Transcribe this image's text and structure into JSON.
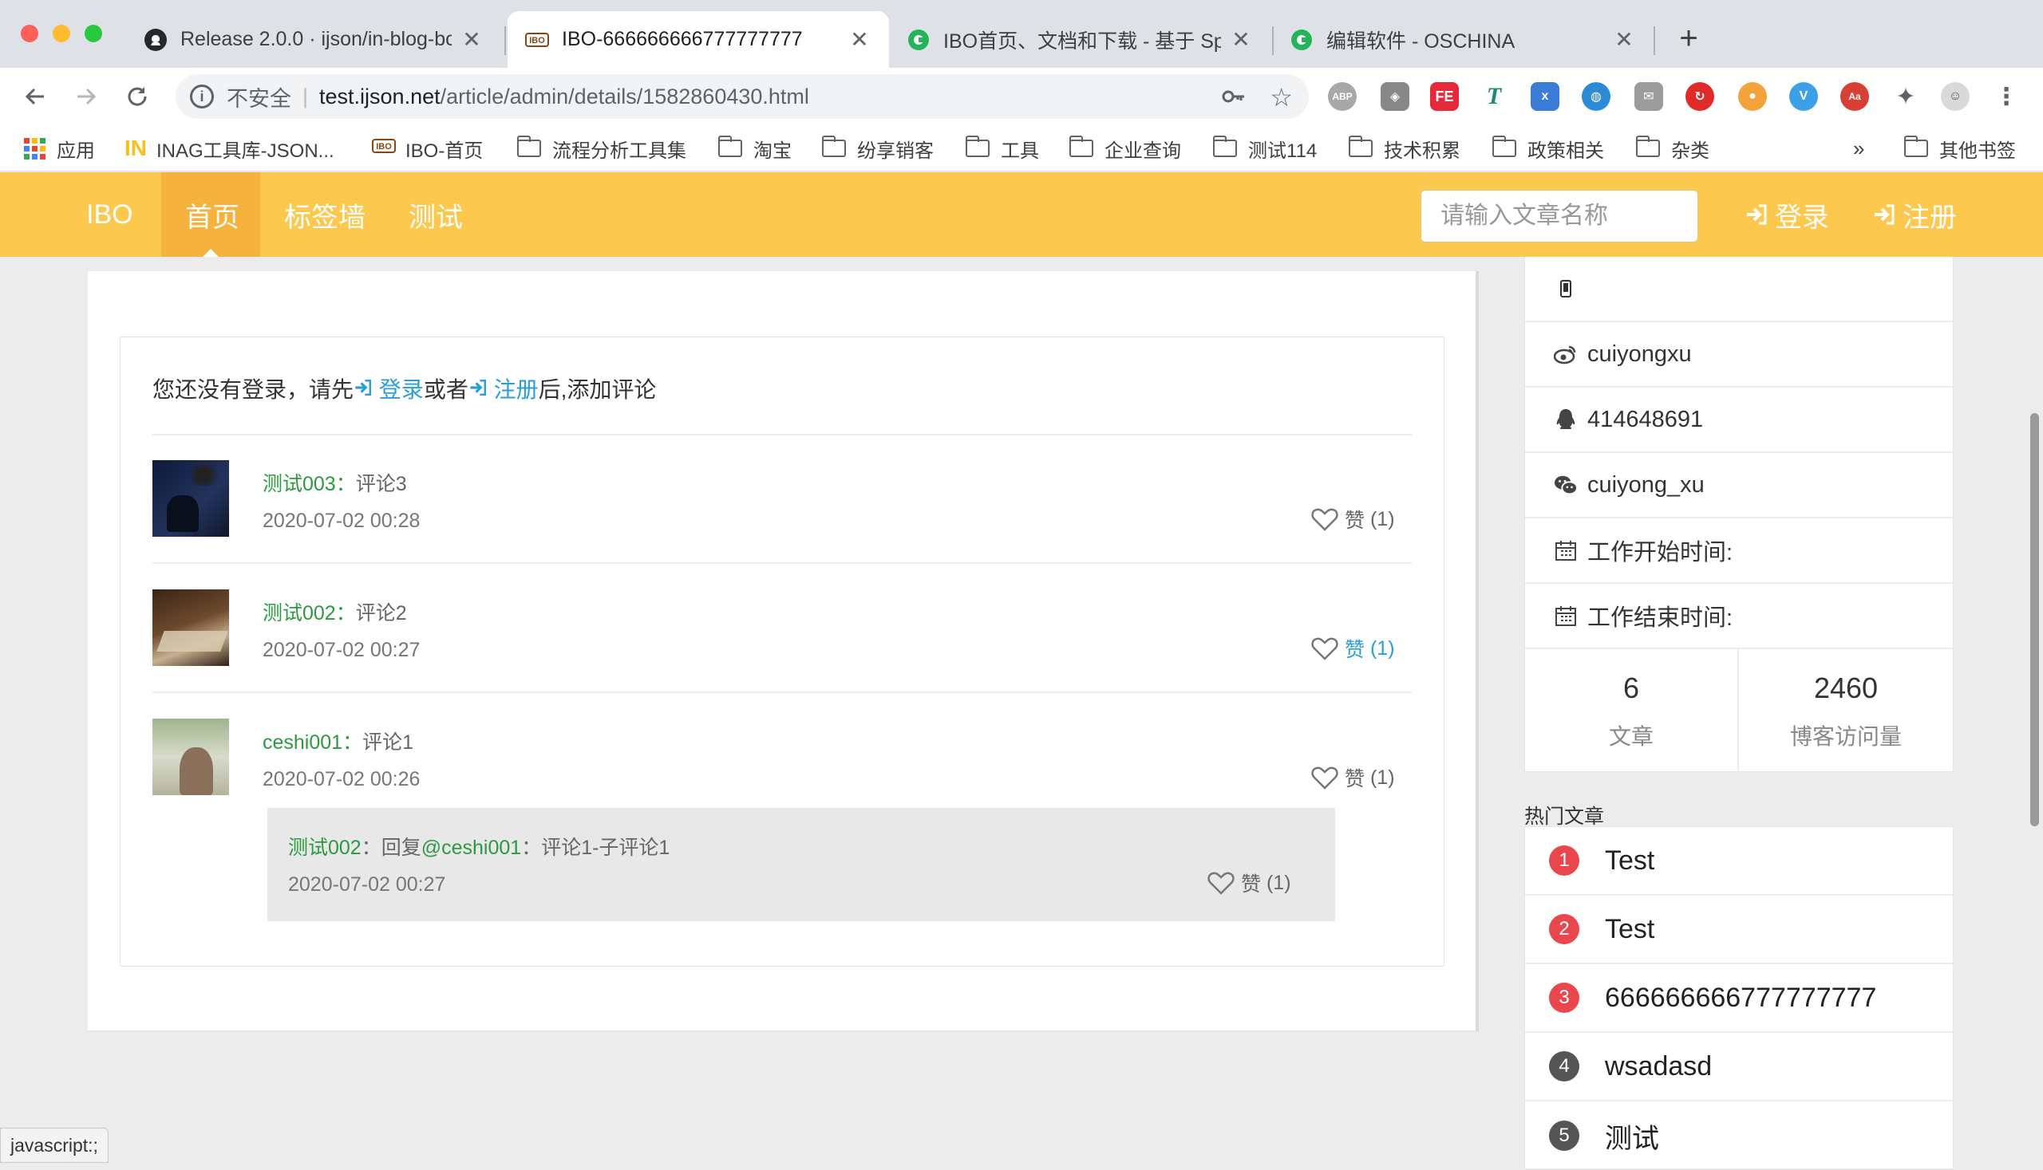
{
  "browser": {
    "tabs": [
      {
        "title": "Release 2.0.0 · ijson/in-blog-bc",
        "favicon": "github-icon"
      },
      {
        "title": "IBO-666666666777777777",
        "favicon": "ibo-icon",
        "active": true
      },
      {
        "title": "IBO首页、文档和下载 - 基于 Sp",
        "favicon": "oschina-icon"
      },
      {
        "title": "编辑软件 - OSCHINA",
        "favicon": "oschina-icon"
      }
    ],
    "security_label": "不安全",
    "url_host": "test.ijson.net",
    "url_path": "/article/admin/details/1582860430.html",
    "bookmarks": [
      {
        "label": "应用",
        "icon": "apps-grid-icon"
      },
      {
        "label": "INAG工具库-JSON...",
        "icon": "inag-icon"
      },
      {
        "label": "IBO-首页",
        "icon": "ibo-icon"
      },
      {
        "label": "流程分析工具集",
        "icon": "folder-icon"
      },
      {
        "label": "淘宝",
        "icon": "folder-icon"
      },
      {
        "label": "纷享销客",
        "icon": "folder-icon"
      },
      {
        "label": "工具",
        "icon": "folder-icon"
      },
      {
        "label": "企业查询",
        "icon": "folder-icon"
      },
      {
        "label": "测试114",
        "icon": "folder-icon"
      },
      {
        "label": "技术积累",
        "icon": "folder-icon"
      },
      {
        "label": "政策相关",
        "icon": "folder-icon"
      },
      {
        "label": "杂类",
        "icon": "folder-icon"
      }
    ],
    "bookmarks_overflow": "»",
    "other_bookmarks": "其他书签",
    "status_url": "javascript:;"
  },
  "site": {
    "brand": "IBO",
    "nav": [
      "首页",
      "标签墙",
      "测试"
    ],
    "search_placeholder": "请输入文章名称",
    "login": "登录",
    "register": "注册",
    "colors": {
      "nav_bg": "#fcc94e",
      "nav_active": "#f5b23c",
      "link": "#2a9fd6",
      "username": "#2c9a3f"
    }
  },
  "comments": {
    "prompt_prefix": "您还没有登录，请先",
    "login": "登录",
    "or": "或者",
    "register": "注册",
    "prompt_suffix": "后,添加评论",
    "items": [
      {
        "user": "测试003：",
        "text": "评论3",
        "time": "2020-07-02 00:28",
        "like_label": "赞",
        "like_count": "(1)"
      },
      {
        "user": "测试002：",
        "text": "评论2",
        "time": "2020-07-02 00:27",
        "like_label": "赞",
        "like_count": "(1)"
      },
      {
        "user": "ceshi001：",
        "text": "评论1",
        "time": "2020-07-02 00:26",
        "like_label": "赞",
        "like_count": "(1)"
      }
    ],
    "reply": {
      "user": "测试002",
      "sep": "：回复",
      "target": "@ceshi001",
      "text": "：评论1-子评论1",
      "time": "2020-07-02 00:27",
      "like_label": "赞",
      "like_count": "(1)"
    }
  },
  "profile": {
    "weibo": "cuiyongxu",
    "qq": "414648691",
    "wechat": "cuiyong_xu",
    "work_start": "工作开始时间:",
    "work_end": "工作结束时间:",
    "articles_count": "6",
    "articles_label": "文章",
    "visits_count": "2460",
    "visits_label": "博客访问量"
  },
  "hot": {
    "title": "热门文章",
    "items": [
      {
        "rank": "1",
        "title": "Test",
        "color": "#e9474d"
      },
      {
        "rank": "2",
        "title": "Test",
        "color": "#e9474d"
      },
      {
        "rank": "3",
        "title": "666666666777777777",
        "color": "#e9474d"
      },
      {
        "rank": "4",
        "title": "wsadasd",
        "color": "#555555"
      },
      {
        "rank": "5",
        "title": "测试",
        "color": "#555555"
      }
    ]
  }
}
